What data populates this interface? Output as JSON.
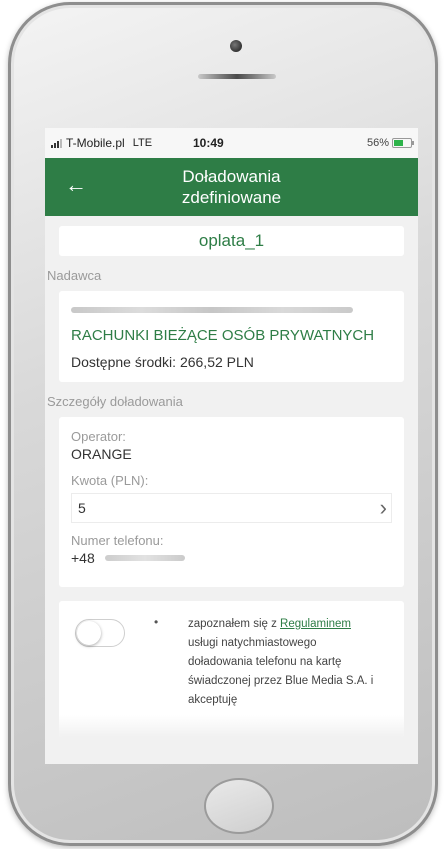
{
  "status": {
    "carrier": "T-Mobile.pl",
    "network": "LTE",
    "time": "10:49",
    "battery": "56%"
  },
  "header": {
    "title": "Doładowania zdefiniowane",
    "back_icon": "arrow-left-icon",
    "color": "#2e7d46"
  },
  "definition": {
    "name": "oplata_1"
  },
  "sender": {
    "section_label": "Nadawca",
    "account_name": "RACHUNKI BIEŻĄCE OSÓB PRYWATNYCH",
    "available_funds": "Dostępne środki: 266,52 PLN"
  },
  "details": {
    "section_label": "Szczegóły doładowania",
    "operator_label": "Operator:",
    "operator_value": "ORANGE",
    "amount_label": "Kwota (PLN):",
    "amount_value": "5",
    "phone_label": "Numer telefonu:",
    "phone_prefix": "+48"
  },
  "consent": {
    "bullet": "•",
    "text_before": "zapoznałem się z ",
    "link_text": "Regulaminem",
    "text_after": " usługi natychmiastowego doładowania telefonu na kartę świadczonej przez Blue Media S.A. i akceptuję",
    "toggle_on": false
  }
}
